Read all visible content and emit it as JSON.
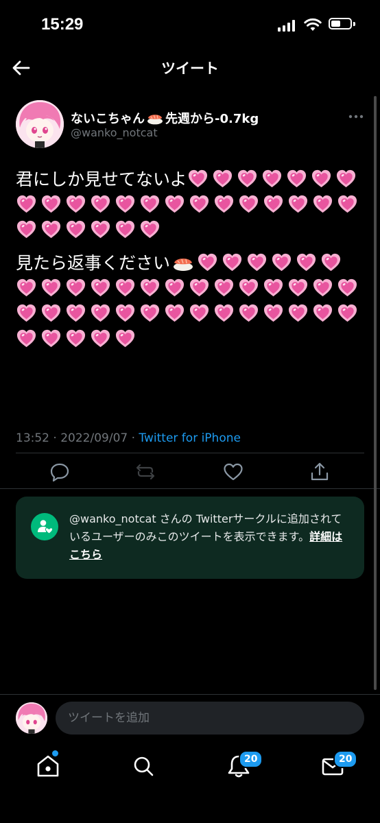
{
  "status_bar": {
    "time": "15:29"
  },
  "header": {
    "title": "ツイート"
  },
  "tweet": {
    "display_name": "ないこちゃん",
    "display_name_suffix": "先週から-0.7kg",
    "handle": "@wanko_notcat",
    "line1_text": "君にしか見せてないよ",
    "line1_hearts": 27,
    "line2_text": "見たら返事ください",
    "line2_hearts": 39,
    "time": "13:52",
    "date": "2022/09/07",
    "separator": "·",
    "source": "Twitter for iPhone"
  },
  "circle_notice": {
    "text": "@wanko_notcat さんの Twitterサークルに追加されているユーザーのみこのツイートを表示できます。",
    "link": "詳細はこちら"
  },
  "reply": {
    "placeholder": "ツイートを追加"
  },
  "tabbar": {
    "notifications_badge": "20",
    "messages_badge": "20"
  },
  "colors": {
    "accent": "#1d9bf0",
    "heart_pink": "#e8559f",
    "notice_bg": "#0e2a21",
    "notice_icon": "#00ba7c"
  }
}
